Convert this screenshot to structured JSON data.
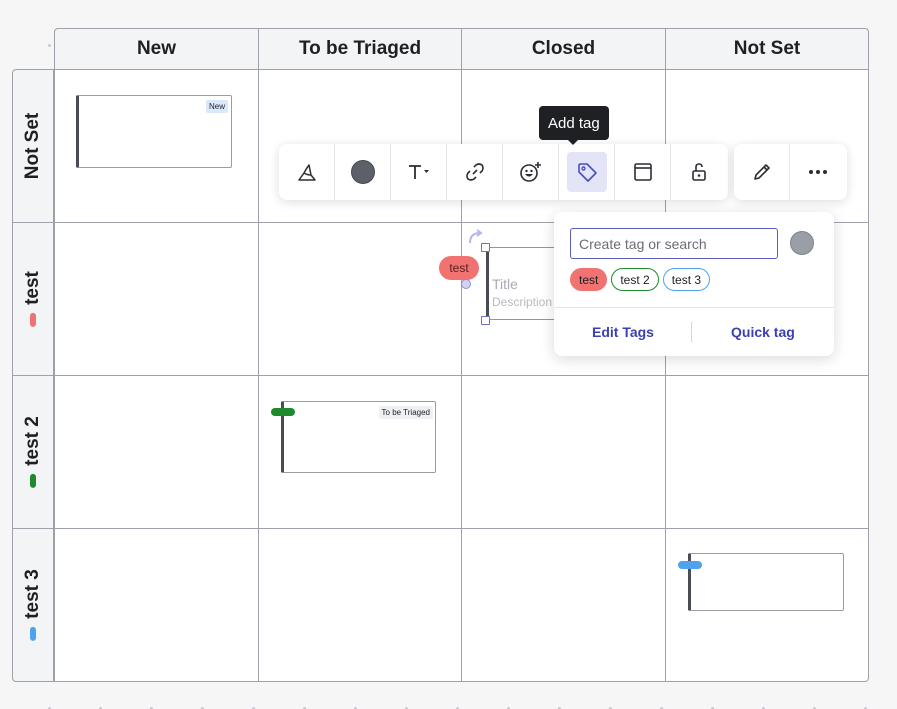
{
  "columns": [
    "New",
    "To be Triaged",
    "Closed",
    "Not Set"
  ],
  "rows": [
    {
      "label": "Not Set",
      "color": ""
    },
    {
      "label": "test",
      "color": "#f07271"
    },
    {
      "label": "test 2",
      "color": "#1f8a2c"
    },
    {
      "label": "test 3",
      "color": "#4fa3ee"
    }
  ],
  "cards": [
    {
      "chip": "New",
      "chip_color": "#dbe8fb"
    },
    {
      "chip": "To be Triaged",
      "chip_color": "#eef0f3",
      "tag_color": "#1f8a2c"
    },
    {
      "chip": "",
      "tag_color": "#4fa3ee"
    }
  ],
  "selected_card": {
    "tag": "test",
    "title": "Title",
    "description": "Description"
  },
  "tooltip": "Add tag",
  "toolbar": {
    "buttons": [
      "shape-icon",
      "color-icon",
      "text-icon",
      "link-icon",
      "emoji-icon",
      "tag-icon",
      "frame-icon",
      "lock-icon"
    ],
    "extra": [
      "edit-icon",
      "more-icon"
    ],
    "fill_color": "#5d5f69"
  },
  "tag_popover": {
    "search_placeholder": "Create tag or search",
    "search_value": "",
    "color": "#9a9ea6",
    "tags": [
      {
        "label": "test",
        "color": "#f07271"
      },
      {
        "label": "test 2",
        "color": "#1f8a2c"
      },
      {
        "label": "test 3",
        "color": "#4fa3ee"
      }
    ],
    "edit_label": "Edit Tags",
    "quick_label": "Quick tag"
  }
}
